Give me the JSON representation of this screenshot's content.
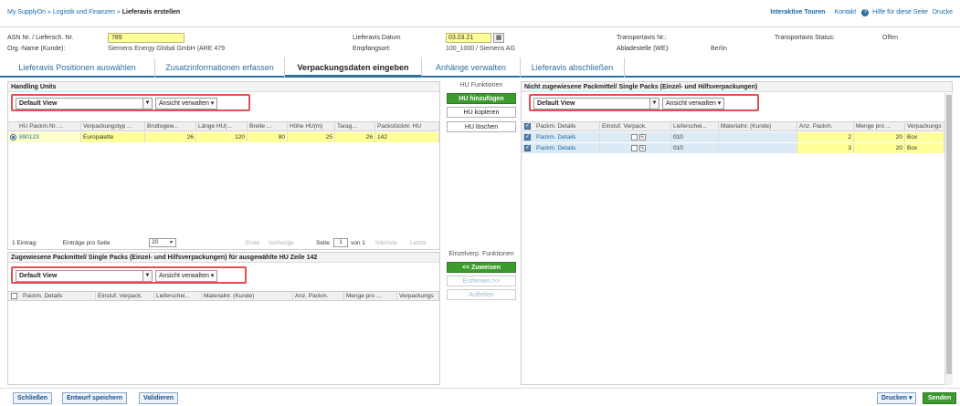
{
  "breadcrumb": {
    "part1": "My SupplyOn",
    "part2": "Logistik und Finanzen",
    "current": "Lieferavis erstellen",
    "sep": "»"
  },
  "toplinks": {
    "tours": "Interaktive Touren",
    "contact": "Kontakt",
    "help": "Hilfe für diese Seite",
    "print": "Drucke"
  },
  "header": {
    "asn_label": "ASN Nr. / Liefersch. Nr.",
    "asn_value": "789",
    "org_label": "Org.-Name (Kunde):",
    "org_value": "Siemens Energy Global GmbH (ARE 479",
    "date_label": "Lieferavis Datum",
    "date_value": "03.03.21",
    "recv_label": "Empfangsort:",
    "recv_value": "100_1000 / Siemens AG",
    "ta_label": "Transportavis Nr.:",
    "ta_value": "",
    "unload_label": "Abladestelle (WE):",
    "unload_value": "Berlin",
    "status_label": "Transportavis Status:",
    "status_value": "Offen"
  },
  "tabs": [
    {
      "label": "Lieferavis Positionen auswählen"
    },
    {
      "label": "Zusatzinformationen erfassen"
    },
    {
      "label": "Verpackungsdaten eingeben"
    },
    {
      "label": "Anhänge verwalten"
    },
    {
      "label": "Lieferavis abschließen"
    }
  ],
  "hu_panel": {
    "title": "Handling Units",
    "view": "Default View",
    "manage": "Ansicht verwalten",
    "columns": [
      "HU Packm.Nr. ...",
      "Verpackungstyp ...",
      "Bruttogew...",
      "Länge HU(...",
      "Breite ...",
      "Höhe HU(m)",
      "Tarag...",
      "Packstücknr. HU"
    ],
    "rows": [
      [
        "890123",
        "Europalette",
        "26",
        "120",
        "80",
        "25",
        "26",
        "142"
      ]
    ],
    "entries": "1 Eintrag:",
    "per_page_label": "Einträge pro Seite",
    "per_page": "20",
    "first": "Erste",
    "prev": "Vorherige",
    "page_label": "Seite",
    "page": "1",
    "of": "von 1",
    "next": "Nächste",
    "last": "Letzte"
  },
  "assigned_panel": {
    "title": "Zugewiesene Packmittel/ Single Packs (Einzel- und Hilfsverpackungen) für ausgewählte HU Zeile 142",
    "view": "Default View",
    "manage": "Ansicht verwalten",
    "columns": [
      "Packm. Details",
      "Einstuf. Verpack.",
      "Lieferschei...",
      "Materialnr. (Kunde)",
      "Anz. Packm.",
      "Menge pro ...",
      "Verpackungs"
    ]
  },
  "hu_functions": {
    "title": "HU Funktionen",
    "add": "HU hinzufügen",
    "copy": "HU kopieren",
    "delete": "HU löschen",
    "single_title": "Einzelverp. Funktionen",
    "assign": "<< Zuweisen",
    "remove": "Entfernen >>",
    "split": "Aufteilen"
  },
  "unassigned_panel": {
    "title": "Nicht zugewiesene Packmittel/ Single Packs (Einzel- und Hilfsverpackungen)",
    "view": "Default View",
    "manage": "Ansicht verwalten",
    "columns": [
      "Packm. Details",
      "Einstuf. Verpack.",
      "Lieferschei...",
      "Materialnr. (Kunde)",
      "Anz. Packm.",
      "Menge pro ...",
      "Verpackungs"
    ],
    "rows": [
      [
        "Packm. Details",
        "010",
        "",
        "2",
        "20",
        "Box"
      ],
      [
        "Packm. Details",
        "010",
        "",
        "3",
        "20",
        "Box"
      ]
    ]
  },
  "footer": {
    "close": "Schließen",
    "save": "Entwurf speichern",
    "validate": "Validieren",
    "print": "Drucken",
    "send": "Senden"
  }
}
